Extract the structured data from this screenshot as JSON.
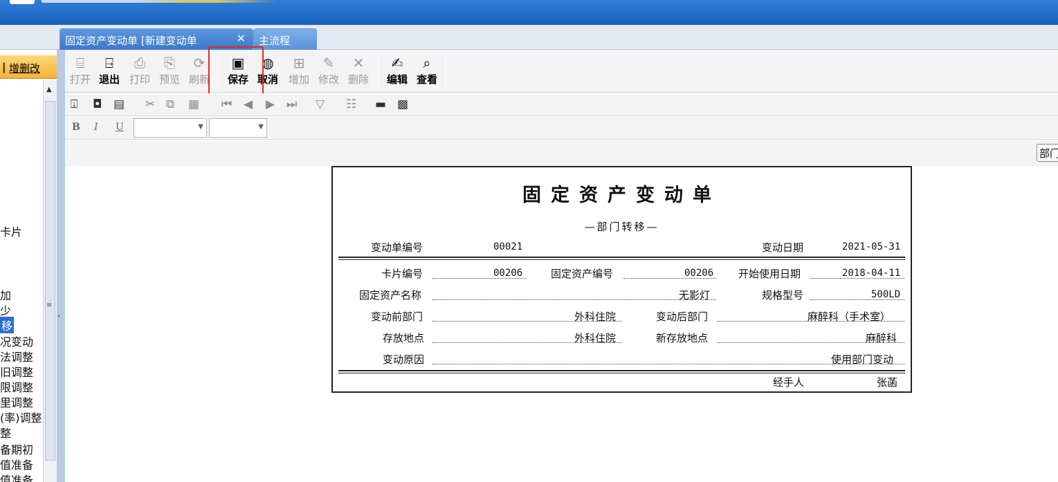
{
  "tabs": {
    "active_label": "固定资产变动单 [新建变动单",
    "close_glyph": "✕",
    "second_label": "主流程"
  },
  "left_panel": {
    "header_pipe": "|",
    "header_label": "增删改",
    "items": [
      "卡片",
      "加",
      "少",
      "移",
      "况变动",
      "法调整",
      "旧调整",
      "限调整",
      "里调整",
      "(率)调整",
      "整",
      "备期初",
      "值准备",
      "值准备"
    ]
  },
  "toolbar": {
    "open": "打开",
    "exit": "退出",
    "print": "打印",
    "preview": "预览",
    "refresh": "刷新",
    "save": "保存",
    "cancel": "取消",
    "add": "增加",
    "modify": "修改",
    "delete": "删除",
    "edit": "编辑",
    "view": "查看"
  },
  "format_bar": {
    "bold": "B",
    "italic": "I",
    "underline": "U"
  },
  "side_button": "部门",
  "form": {
    "title": "固定资产变动单",
    "subtitle": "—部门转移—",
    "change_no_label": "变动单编号",
    "change_no": "00021",
    "change_date_label": "变动日期",
    "change_date": "2021-05-31",
    "card_no_label": "卡片编号",
    "card_no": "00206",
    "asset_no_label": "固定资产编号",
    "asset_no": "00206",
    "start_date_label": "开始使用日期",
    "start_date": "2018-04-11",
    "asset_name_label": "固定资产名称",
    "asset_name": "无影灯",
    "spec_label": "规格型号",
    "spec": "500LD",
    "dept_before_label": "变动前部门",
    "dept_before": "外科住院",
    "dept_after_label": "变动后部门",
    "dept_after": "麻醉科（手术室）",
    "location_label": "存放地点",
    "location": "外科住院",
    "new_location_label": "新存放地点",
    "new_location": "麻醉科",
    "reason_label": "变动原因",
    "reason": "使用部门变动",
    "handler_label": "经手人",
    "handler": "张菡"
  }
}
